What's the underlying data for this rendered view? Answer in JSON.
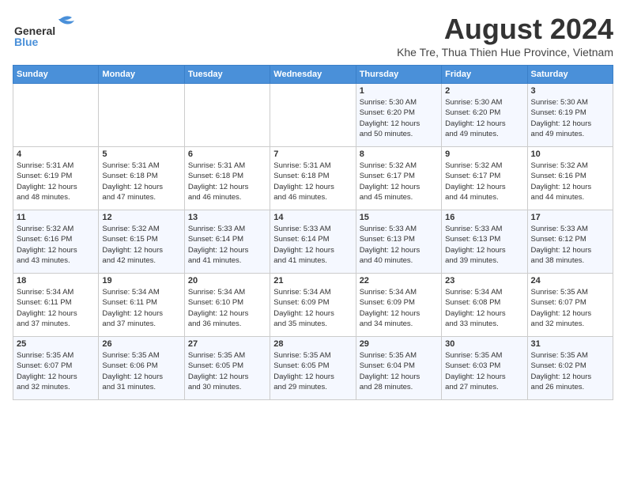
{
  "header": {
    "logo_line1": "General",
    "logo_line2": "Blue",
    "month_year": "August 2024",
    "location": "Khe Tre, Thua Thien Hue Province, Vietnam"
  },
  "weekdays": [
    "Sunday",
    "Monday",
    "Tuesday",
    "Wednesday",
    "Thursday",
    "Friday",
    "Saturday"
  ],
  "weeks": [
    [
      {
        "day": "",
        "info": ""
      },
      {
        "day": "",
        "info": ""
      },
      {
        "day": "",
        "info": ""
      },
      {
        "day": "",
        "info": ""
      },
      {
        "day": "1",
        "info": "Sunrise: 5:30 AM\nSunset: 6:20 PM\nDaylight: 12 hours\nand 50 minutes."
      },
      {
        "day": "2",
        "info": "Sunrise: 5:30 AM\nSunset: 6:20 PM\nDaylight: 12 hours\nand 49 minutes."
      },
      {
        "day": "3",
        "info": "Sunrise: 5:30 AM\nSunset: 6:19 PM\nDaylight: 12 hours\nand 49 minutes."
      }
    ],
    [
      {
        "day": "4",
        "info": "Sunrise: 5:31 AM\nSunset: 6:19 PM\nDaylight: 12 hours\nand 48 minutes."
      },
      {
        "day": "5",
        "info": "Sunrise: 5:31 AM\nSunset: 6:18 PM\nDaylight: 12 hours\nand 47 minutes."
      },
      {
        "day": "6",
        "info": "Sunrise: 5:31 AM\nSunset: 6:18 PM\nDaylight: 12 hours\nand 46 minutes."
      },
      {
        "day": "7",
        "info": "Sunrise: 5:31 AM\nSunset: 6:18 PM\nDaylight: 12 hours\nand 46 minutes."
      },
      {
        "day": "8",
        "info": "Sunrise: 5:32 AM\nSunset: 6:17 PM\nDaylight: 12 hours\nand 45 minutes."
      },
      {
        "day": "9",
        "info": "Sunrise: 5:32 AM\nSunset: 6:17 PM\nDaylight: 12 hours\nand 44 minutes."
      },
      {
        "day": "10",
        "info": "Sunrise: 5:32 AM\nSunset: 6:16 PM\nDaylight: 12 hours\nand 44 minutes."
      }
    ],
    [
      {
        "day": "11",
        "info": "Sunrise: 5:32 AM\nSunset: 6:16 PM\nDaylight: 12 hours\nand 43 minutes."
      },
      {
        "day": "12",
        "info": "Sunrise: 5:32 AM\nSunset: 6:15 PM\nDaylight: 12 hours\nand 42 minutes."
      },
      {
        "day": "13",
        "info": "Sunrise: 5:33 AM\nSunset: 6:14 PM\nDaylight: 12 hours\nand 41 minutes."
      },
      {
        "day": "14",
        "info": "Sunrise: 5:33 AM\nSunset: 6:14 PM\nDaylight: 12 hours\nand 41 minutes."
      },
      {
        "day": "15",
        "info": "Sunrise: 5:33 AM\nSunset: 6:13 PM\nDaylight: 12 hours\nand 40 minutes."
      },
      {
        "day": "16",
        "info": "Sunrise: 5:33 AM\nSunset: 6:13 PM\nDaylight: 12 hours\nand 39 minutes."
      },
      {
        "day": "17",
        "info": "Sunrise: 5:33 AM\nSunset: 6:12 PM\nDaylight: 12 hours\nand 38 minutes."
      }
    ],
    [
      {
        "day": "18",
        "info": "Sunrise: 5:34 AM\nSunset: 6:11 PM\nDaylight: 12 hours\nand 37 minutes."
      },
      {
        "day": "19",
        "info": "Sunrise: 5:34 AM\nSunset: 6:11 PM\nDaylight: 12 hours\nand 37 minutes."
      },
      {
        "day": "20",
        "info": "Sunrise: 5:34 AM\nSunset: 6:10 PM\nDaylight: 12 hours\nand 36 minutes."
      },
      {
        "day": "21",
        "info": "Sunrise: 5:34 AM\nSunset: 6:09 PM\nDaylight: 12 hours\nand 35 minutes."
      },
      {
        "day": "22",
        "info": "Sunrise: 5:34 AM\nSunset: 6:09 PM\nDaylight: 12 hours\nand 34 minutes."
      },
      {
        "day": "23",
        "info": "Sunrise: 5:34 AM\nSunset: 6:08 PM\nDaylight: 12 hours\nand 33 minutes."
      },
      {
        "day": "24",
        "info": "Sunrise: 5:35 AM\nSunset: 6:07 PM\nDaylight: 12 hours\nand 32 minutes."
      }
    ],
    [
      {
        "day": "25",
        "info": "Sunrise: 5:35 AM\nSunset: 6:07 PM\nDaylight: 12 hours\nand 32 minutes."
      },
      {
        "day": "26",
        "info": "Sunrise: 5:35 AM\nSunset: 6:06 PM\nDaylight: 12 hours\nand 31 minutes."
      },
      {
        "day": "27",
        "info": "Sunrise: 5:35 AM\nSunset: 6:05 PM\nDaylight: 12 hours\nand 30 minutes."
      },
      {
        "day": "28",
        "info": "Sunrise: 5:35 AM\nSunset: 6:05 PM\nDaylight: 12 hours\nand 29 minutes."
      },
      {
        "day": "29",
        "info": "Sunrise: 5:35 AM\nSunset: 6:04 PM\nDaylight: 12 hours\nand 28 minutes."
      },
      {
        "day": "30",
        "info": "Sunrise: 5:35 AM\nSunset: 6:03 PM\nDaylight: 12 hours\nand 27 minutes."
      },
      {
        "day": "31",
        "info": "Sunrise: 5:35 AM\nSunset: 6:02 PM\nDaylight: 12 hours\nand 26 minutes."
      }
    ]
  ]
}
